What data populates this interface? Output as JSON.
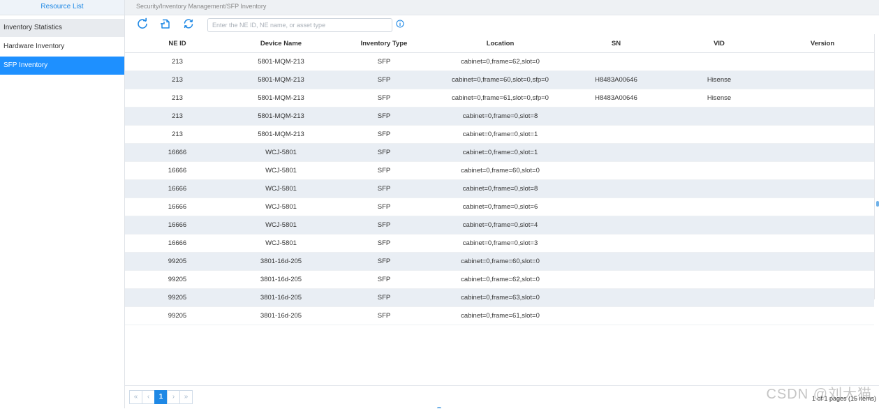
{
  "sidebar": {
    "header": "Resource List",
    "items": [
      {
        "label": "Inventory Statistics"
      },
      {
        "label": "Hardware Inventory"
      },
      {
        "label": "SFP Inventory"
      }
    ]
  },
  "breadcrumb": "Security/Inventory Management/SFP Inventory",
  "toolbar": {
    "icons": [
      "refresh-icon",
      "export-icon",
      "sync-icon"
    ],
    "search_placeholder": "Enter the NE ID, NE name, or asset type",
    "info_icon": "info-icon"
  },
  "table": {
    "columns": [
      "NE ID",
      "Device Name",
      "Inventory Type",
      "Location",
      "SN",
      "VID",
      "Version"
    ],
    "rows": [
      [
        "213",
        "5801-MQM-213",
        "SFP",
        "cabinet=0,frame=62,slot=0",
        "",
        "",
        ""
      ],
      [
        "213",
        "5801-MQM-213",
        "SFP",
        "cabinet=0,frame=60,slot=0,sfp=0",
        "H8483A00646",
        "Hisense",
        ""
      ],
      [
        "213",
        "5801-MQM-213",
        "SFP",
        "cabinet=0,frame=61,slot=0,sfp=0",
        "H8483A00646",
        "Hisense",
        ""
      ],
      [
        "213",
        "5801-MQM-213",
        "SFP",
        "cabinet=0,frame=0,slot=8",
        "",
        "",
        ""
      ],
      [
        "213",
        "5801-MQM-213",
        "SFP",
        "cabinet=0,frame=0,slot=1",
        "",
        "",
        ""
      ],
      [
        "16666",
        "WCJ-5801",
        "SFP",
        "cabinet=0,frame=0,slot=1",
        "",
        "",
        ""
      ],
      [
        "16666",
        "WCJ-5801",
        "SFP",
        "cabinet=0,frame=60,slot=0",
        "",
        "",
        ""
      ],
      [
        "16666",
        "WCJ-5801",
        "SFP",
        "cabinet=0,frame=0,slot=8",
        "",
        "",
        ""
      ],
      [
        "16666",
        "WCJ-5801",
        "SFP",
        "cabinet=0,frame=0,slot=6",
        "",
        "",
        ""
      ],
      [
        "16666",
        "WCJ-5801",
        "SFP",
        "cabinet=0,frame=0,slot=4",
        "",
        "",
        ""
      ],
      [
        "16666",
        "WCJ-5801",
        "SFP",
        "cabinet=0,frame=0,slot=3",
        "",
        "",
        ""
      ],
      [
        "99205",
        "3801-16d-205",
        "SFP",
        "cabinet=0,frame=60,slot=0",
        "",
        "",
        ""
      ],
      [
        "99205",
        "3801-16d-205",
        "SFP",
        "cabinet=0,frame=62,slot=0",
        "",
        "",
        ""
      ],
      [
        "99205",
        "3801-16d-205",
        "SFP",
        "cabinet=0,frame=63,slot=0",
        "",
        "",
        ""
      ],
      [
        "99205",
        "3801-16d-205",
        "SFP",
        "cabinet=0,frame=61,slot=0",
        "",
        "",
        ""
      ]
    ]
  },
  "pagination": {
    "first": "«",
    "prev": "‹",
    "current": "1",
    "next": "›",
    "last": "»",
    "info": "1 of 1 pages (15 items)"
  },
  "watermark": "CSDN @刘大猫",
  "colors": {
    "accent": "#1e88e5",
    "selected_bg": "#1e90ff",
    "alt_row": "#e9eef4"
  }
}
